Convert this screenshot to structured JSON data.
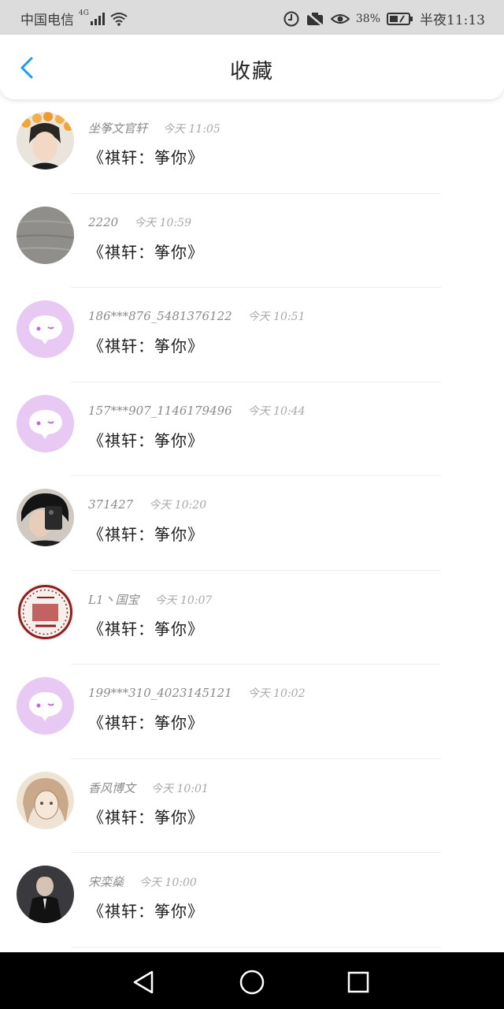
{
  "status_bar": {
    "carrier": "中国电信",
    "network": "4G",
    "battery": "38%",
    "time": "半夜11:13",
    "icons": [
      "signal-icon",
      "wifi-icon",
      "data-saver-icon",
      "no-sim-icon",
      "eye-comfort-icon",
      "battery-icon"
    ]
  },
  "header": {
    "title": "收藏",
    "back_icon": "chevron-left-icon",
    "accent": "#1e9bf0"
  },
  "list": [
    {
      "name": "坐筝文官轩",
      "time": "今天 11:05",
      "message": "《祺轩：筝你》",
      "avatar": "photo-orange-flowers"
    },
    {
      "name": "2220",
      "time": "今天 10:59",
      "message": "《祺轩：筝你》",
      "avatar": "photo-gray-wood"
    },
    {
      "name": "186***876_5481376122",
      "time": "今天 10:51",
      "message": "《祺轩：筝你》",
      "avatar": "default-chat-bubble"
    },
    {
      "name": "157***907_1146179496",
      "time": "今天 10:44",
      "message": "《祺轩：筝你》",
      "avatar": "default-chat-bubble"
    },
    {
      "name": "371427",
      "time": "今天 10:20",
      "message": "《祺轩：筝你》",
      "avatar": "photo-phone-selfie"
    },
    {
      "name": "L1丶国宝",
      "time": "今天 10:07",
      "message": "《祺轩：筝你》",
      "avatar": "photo-red-seal"
    },
    {
      "name": "199***310_4023145121",
      "time": "今天 10:02",
      "message": "《祺轩：筝你》",
      "avatar": "default-chat-bubble"
    },
    {
      "name": "香风博文",
      "time": "今天 10:01",
      "message": "《祺轩：筝你》",
      "avatar": "photo-sketch-girl"
    },
    {
      "name": "宋栾燊",
      "time": "今天 10:00",
      "message": "《祺轩：筝你》",
      "avatar": "photo-dark-suit"
    }
  ],
  "colors": {
    "default_avatar_bg": "#e7c9f4",
    "default_avatar_icon": "#ffffff",
    "name_text": "#8a8a8a",
    "message_text": "#1e1e1e"
  },
  "nav_bar": {
    "icons": [
      "back-triangle-icon",
      "home-circle-icon",
      "recents-square-icon"
    ]
  }
}
